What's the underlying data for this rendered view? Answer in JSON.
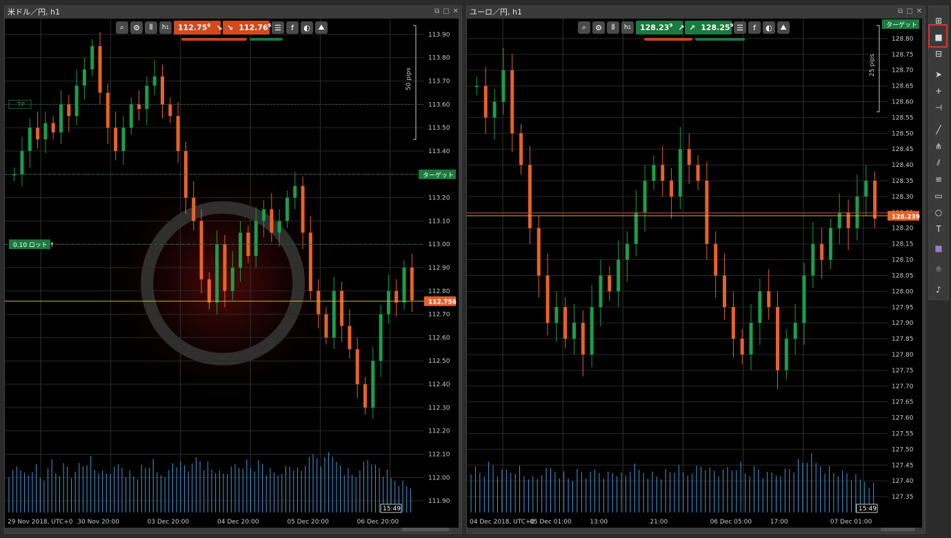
{
  "left": {
    "title": "米ドル／円, h1",
    "timeframe": "h",
    "timeframe_sub": "1",
    "sell_price": "112.75",
    "sell_sup": "6",
    "buy_price": "112.76",
    "buy_sup": "6",
    "pips_label": "50 pips",
    "tp_label": "TP",
    "lot_label": "0.10 ロット",
    "target_label": "ターゲット",
    "price_tag": "112.756",
    "time_tag": "15:49"
  },
  "right": {
    "title": "ユーロ／円, h1",
    "timeframe": "h",
    "timeframe_sub": "1",
    "sell_price": "128.23",
    "sell_sup": "9",
    "buy_price": "128.25",
    "buy_sup": "9",
    "pips_label": "25 pips",
    "target_label": "ターゲット",
    "price_tag": "128.239",
    "price_tag2": "128.250",
    "time_tag": "15:49"
  },
  "colors": {
    "up": "#1b9e4b",
    "down": "#e8622a",
    "volume": "#3fa0e0",
    "grid": "#2a2a2a",
    "highlight": "#e03030"
  },
  "chart_data": [
    {
      "type": "candlestick",
      "title": "米ドル／円, h1",
      "ylim": [
        111.85,
        113.95
      ],
      "y_ticks": [
        "113.90",
        "113.80",
        "113.70",
        "113.60",
        "113.50",
        "113.40",
        "113.30",
        "113.20",
        "113.10",
        "113.00",
        "112.90",
        "112.80",
        "112.70",
        "112.60",
        "112.50",
        "112.40",
        "112.30",
        "112.20",
        "112.10",
        "112.00",
        "111.90"
      ],
      "x_ticks": [
        "29 Nov 2018, UTC+0",
        "30 Nov 20:00",
        "03 Dec 20:00",
        "04 Dec 20:00",
        "05 Dec 20:00",
        "06 Dec 20:00"
      ],
      "current_price": 112.756,
      "target_level": 113.3,
      "tp_level": 113.6,
      "lot_level": 113.0,
      "close_path": [
        113.3,
        113.4,
        113.5,
        113.45,
        113.52,
        113.48,
        113.6,
        113.55,
        113.68,
        113.75,
        113.85,
        113.65,
        113.5,
        113.4,
        113.5,
        113.6,
        113.58,
        113.68,
        113.72,
        113.6,
        113.55,
        113.4,
        113.2,
        113.1,
        112.85,
        112.75,
        113.0,
        112.8,
        112.9,
        113.05,
        112.95,
        113.1,
        113.15,
        113.05,
        113.1,
        113.2,
        113.25,
        113.05,
        112.8,
        112.7,
        112.6,
        112.8,
        112.65,
        112.55,
        112.4,
        112.3,
        112.5,
        112.7,
        112.8,
        112.75,
        112.9,
        112.76
      ],
      "volume_path": [
        60,
        70,
        55,
        65,
        50,
        75,
        60,
        68,
        55,
        72,
        80,
        65,
        58,
        62,
        70,
        60,
        55,
        66,
        72,
        58,
        60,
        75,
        70,
        66,
        80,
        72,
        65,
        58,
        62,
        70,
        75,
        68,
        72,
        60,
        58,
        66,
        70,
        62,
        75,
        85,
        78,
        92,
        70,
        60,
        55,
        72,
        80,
        66,
        58,
        50,
        45,
        40
      ]
    },
    {
      "type": "candlestick",
      "title": "ユーロ／円, h1",
      "ylim": [
        127.3,
        128.85
      ],
      "y_ticks": [
        "128.80",
        "128.75",
        "128.70",
        "128.65",
        "128.60",
        "128.55",
        "128.50",
        "128.45",
        "128.40",
        "128.35",
        "128.30",
        "128.25",
        "128.20",
        "128.15",
        "128.10",
        "128.05",
        "128.00",
        "127.95",
        "127.90",
        "127.85",
        "127.80",
        "127.75",
        "127.70",
        "127.65",
        "127.60",
        "127.55",
        "127.50",
        "127.45",
        "127.40",
        "127.35"
      ],
      "x_ticks": [
        "04 Dec 2018, UTC+0",
        "05 Dec 01:00",
        "13:00",
        "21:00",
        "06 Dec 05:00",
        "17:00",
        "07 Dec 01:00"
      ],
      "current_price": 128.239,
      "close_path": [
        128.65,
        128.55,
        128.6,
        128.7,
        128.5,
        128.4,
        128.2,
        128.05,
        127.9,
        127.95,
        127.85,
        127.9,
        127.8,
        127.95,
        128.05,
        128.0,
        128.1,
        128.15,
        128.25,
        128.35,
        128.4,
        128.35,
        128.3,
        128.45,
        128.4,
        128.35,
        128.15,
        128.05,
        127.95,
        127.85,
        127.8,
        127.9,
        128.0,
        127.95,
        127.75,
        127.85,
        127.9,
        128.05,
        128.15,
        128.1,
        128.2,
        128.25,
        128.2,
        128.3,
        128.35,
        128.23
      ],
      "volume_path": [
        65,
        60,
        70,
        58,
        62,
        66,
        55,
        50,
        60,
        64,
        58,
        52,
        60,
        55,
        62,
        58,
        60,
        55,
        66,
        62,
        58,
        55,
        60,
        64,
        58,
        66,
        70,
        62,
        58,
        66,
        72,
        60,
        64,
        55,
        58,
        62,
        66,
        74,
        80,
        72,
        66,
        60,
        58,
        52,
        48,
        42
      ]
    }
  ],
  "sidebar": {
    "icons": [
      "layout-multi-icon",
      "layout-single-icon",
      "layout-split-icon",
      "cursor-icon",
      "crosshair-icon",
      "measure-icon",
      "trendline-icon",
      "fan-icon",
      "channel-icon",
      "fib-icon",
      "rectangle-icon",
      "ellipse-icon",
      "text-icon",
      "color-icon",
      "camera-icon",
      "bell-icon"
    ]
  }
}
